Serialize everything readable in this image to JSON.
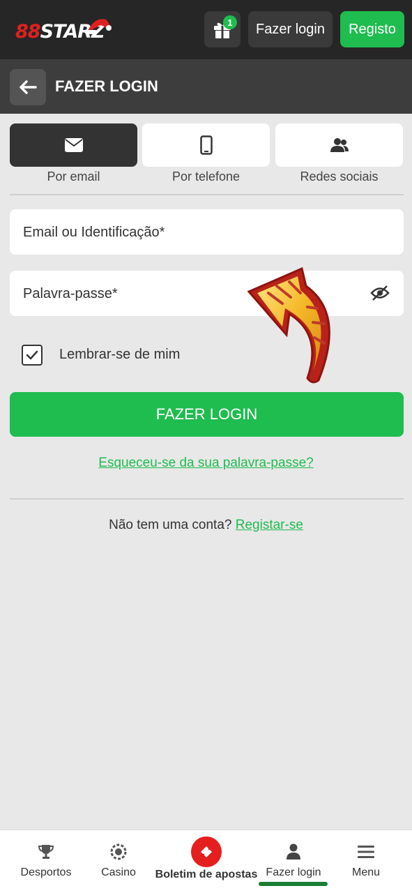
{
  "header": {
    "logo_text_a": "88",
    "logo_text_b": "STARZ",
    "gift_badge": "1",
    "login_label": "Fazer login",
    "register_label": "Registo"
  },
  "titlebar": {
    "title": "FAZER LOGIN"
  },
  "tabs": [
    {
      "label": "Por email",
      "icon": "envelope-icon",
      "active": true
    },
    {
      "label": "Por telefone",
      "icon": "phone-icon",
      "active": false
    },
    {
      "label": "Redes sociais",
      "icon": "users-icon",
      "active": false
    }
  ],
  "form": {
    "email_placeholder": "Email ou Identificação*",
    "password_placeholder": "Palavra-passe*",
    "remember_label": "Lembrar-se de mim",
    "remember_checked": true,
    "submit_label": "FAZER LOGIN",
    "forgot_link": "Esqueceu-se da sua palavra-passe?",
    "signup_prompt": "Não tem uma conta?",
    "signup_link": "Registar-se"
  },
  "bottom_nav": [
    {
      "label": "Desportos",
      "icon": "trophy-icon"
    },
    {
      "label": "Casino",
      "icon": "chip-icon"
    },
    {
      "label": "Boletim de apostas",
      "icon": "ticket-icon"
    },
    {
      "label": "Fazer login",
      "icon": "user-icon",
      "active": true
    },
    {
      "label": "Menu",
      "icon": "menu-icon"
    }
  ],
  "colors": {
    "accent": "#1fbc4f",
    "header_bg": "#262626",
    "titlebar_bg": "#3d3d3d",
    "betslip": "#e51e1e"
  }
}
